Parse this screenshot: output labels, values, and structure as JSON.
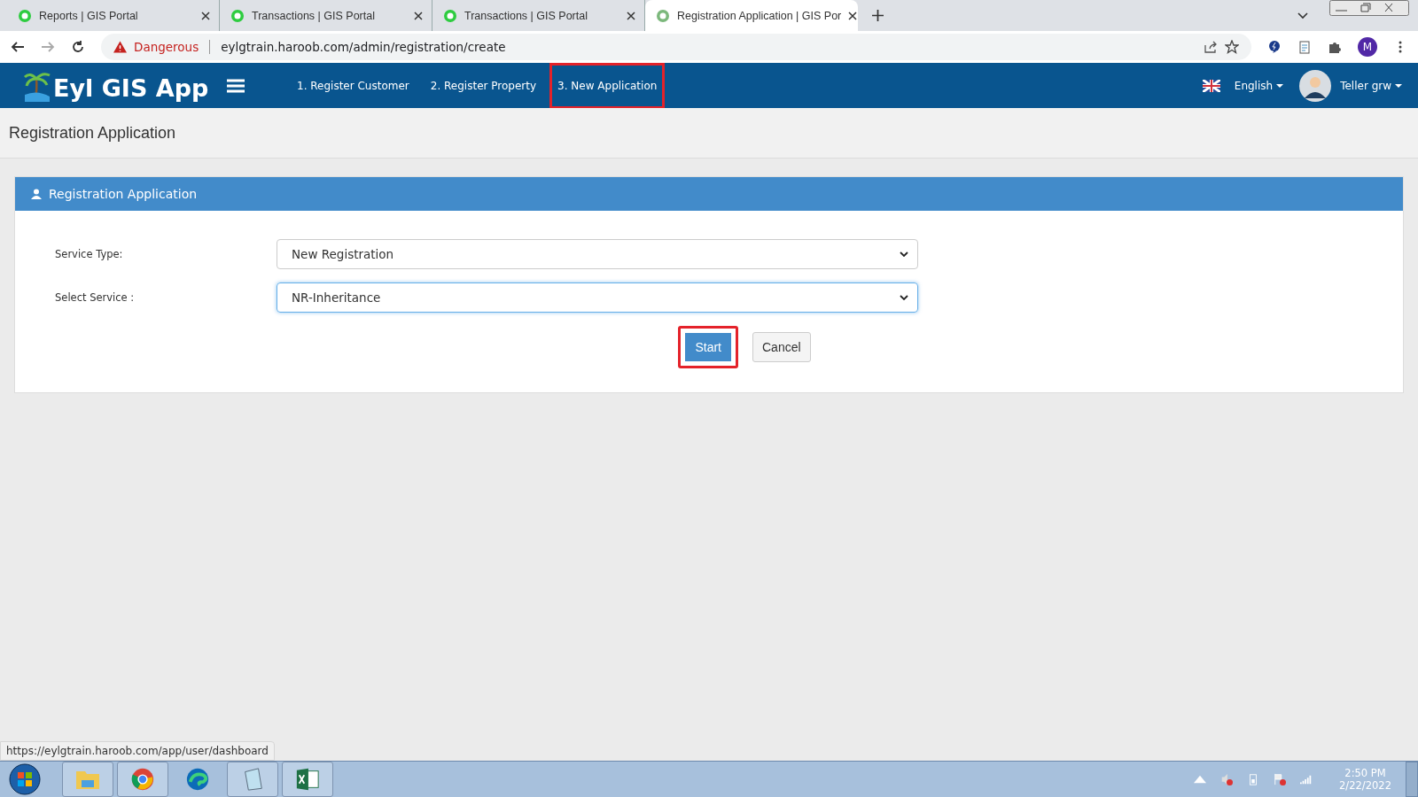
{
  "browser": {
    "tabs": [
      {
        "title": "Reports | GIS Portal",
        "selected": false
      },
      {
        "title": "Transactions | GIS Portal",
        "selected": false
      },
      {
        "title": "Transactions | GIS Portal",
        "selected": false
      },
      {
        "title": "Registration Application | GIS Por",
        "selected": true
      }
    ],
    "address": {
      "warning": "Dangerous",
      "url": "eylgtrain.haroob.com/admin/registration/create"
    },
    "profile_initial": "M"
  },
  "app": {
    "brand": "Eyl GIS App",
    "nav": [
      {
        "label": "1. Register Customer",
        "highlighted": false
      },
      {
        "label": "2. Register Property",
        "highlighted": false
      },
      {
        "label": "3. New Application",
        "highlighted": true
      }
    ],
    "language": "English",
    "user": "Teller grw"
  },
  "page_title": "Registration Application",
  "panel": {
    "title": "Registration Application",
    "fields": [
      {
        "label": "Service Type:",
        "value": "New Registration",
        "focused": false
      },
      {
        "label": "Select Service :",
        "value": "NR-Inheritance",
        "focused": true
      }
    ],
    "buttons": [
      {
        "label": "Start",
        "kind": "primary",
        "highlighted": true
      },
      {
        "label": "Cancel",
        "kind": "default",
        "highlighted": false
      }
    ]
  },
  "status_url": "https://eylgtrain.haroob.com/app/user/dashboard",
  "taskbar": {
    "time": "2:50 PM",
    "date": "2/22/2022"
  }
}
